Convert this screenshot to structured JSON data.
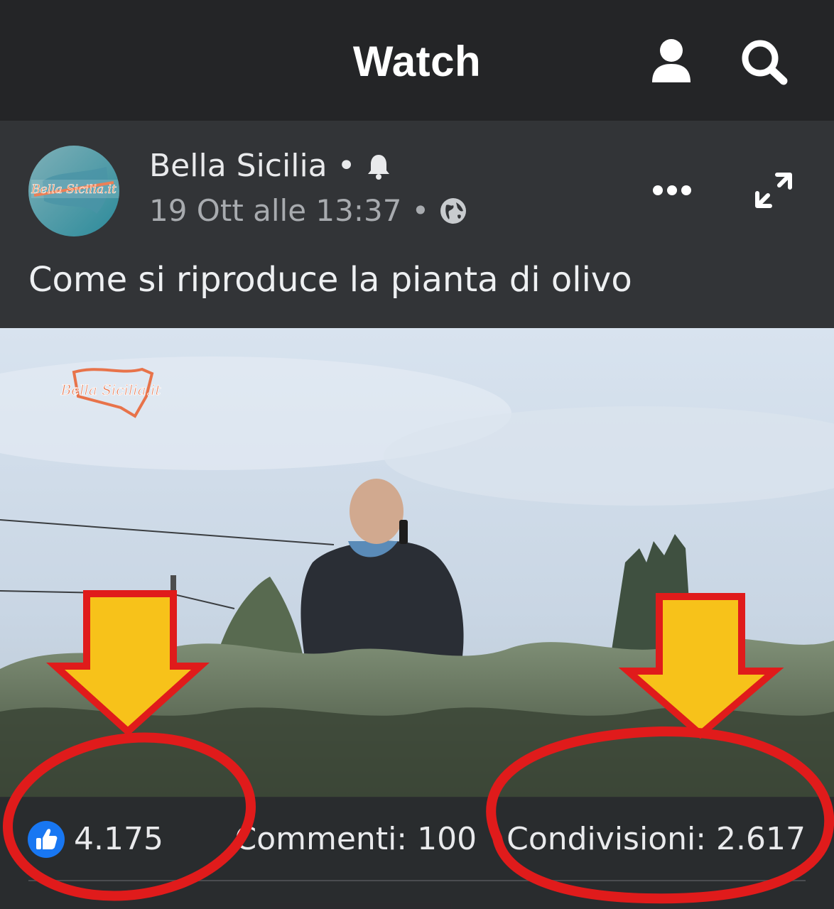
{
  "app": {
    "title": "Watch"
  },
  "icons": {
    "profile": "profile-icon",
    "search": "search-icon",
    "bell": "bell-icon",
    "globe": "globe-icon",
    "more": "more-options-icon",
    "expand": "expand-icon",
    "like": "like-icon",
    "arrow": "arrow-down-icon"
  },
  "post": {
    "page_name": "Bella Sicilia",
    "date": "19 Ott alle 13:37",
    "separator": "•",
    "caption": "Come si riproduce la pianta di olivo",
    "logo_text": "Bella Sicilia.it"
  },
  "stats": {
    "likes": "4.175",
    "comments_label": "Commenti: 100",
    "shares_label": "Condivisioni: 2.617"
  },
  "colors": {
    "background": "#242527",
    "post_bg": "#323437",
    "annotation_red": "#e01b1b",
    "annotation_arrow": "#f7c21a",
    "like_blue": "#1877f2"
  }
}
